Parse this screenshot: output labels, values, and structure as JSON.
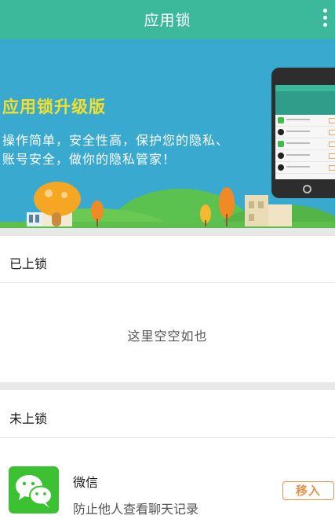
{
  "header": {
    "title": "应用锁",
    "more_icon": "more-vertical-icon"
  },
  "banner": {
    "headline": "应用锁升级版",
    "description": "操作简单，安全性高，保护您的隐私、账号安全，做你的隐私管家！"
  },
  "locked": {
    "title": "已上锁",
    "empty_text": "这里空空如也"
  },
  "unlocked": {
    "title": "未上锁",
    "items": [
      {
        "name": "微信",
        "description": "防止他人查看聊天记录",
        "icon": "wechat-icon",
        "action_label": "移入"
      }
    ]
  },
  "colors": {
    "header_bg": "#3cb89a",
    "banner_bg": "#3aa9cf",
    "headline_yellow": "#f4e02c",
    "action_orange": "#e4924d",
    "wechat_green": "#3cc133"
  }
}
